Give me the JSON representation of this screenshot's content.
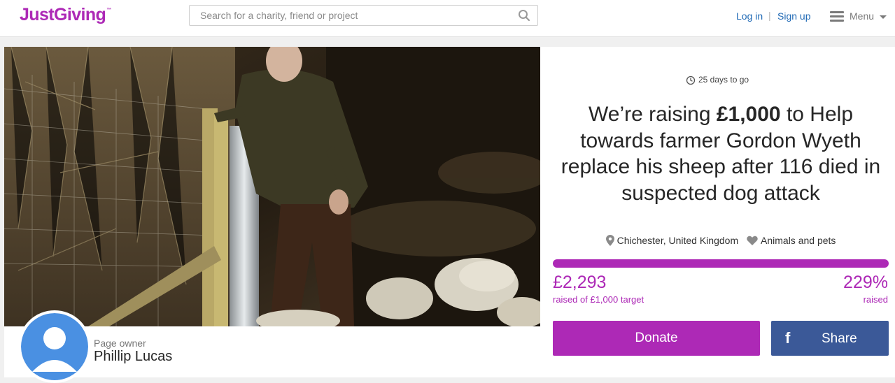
{
  "header": {
    "logo_text": "JustGiving",
    "logo_tm": "™",
    "search_placeholder": "Search for a charity, friend or project",
    "search_icon": "search-icon",
    "login_label": "Log in",
    "separator": "|",
    "signup_label": "Sign up",
    "menu_label": "Menu",
    "menu_icon": "hamburger-icon"
  },
  "hero": {
    "image_description": "farmer-with-sheep-photo"
  },
  "owner": {
    "label": "Page owner",
    "name": "Phillip Lucas"
  },
  "campaign": {
    "days_left": "25 days to go",
    "headline_prefix": "We’re raising ",
    "headline_target": "£1,000",
    "headline_suffix": " to Help towards farmer Gordon Wyeth replace his sheep after 116 died in suspected dog attack",
    "location": "Chichester, United Kingdom",
    "category": "Animals and pets",
    "raised_amount": "£2,293",
    "raised_sub": "raised of £1,000 target",
    "percent": "229%",
    "percent_sub": "raised",
    "progress_fraction": 1.0
  },
  "actions": {
    "donate_label": "Donate",
    "share_label": "Share",
    "share_icon": "f"
  },
  "colors": {
    "brand": "#ad29b6",
    "facebook": "#3b5998",
    "link": "#1f69b5"
  }
}
